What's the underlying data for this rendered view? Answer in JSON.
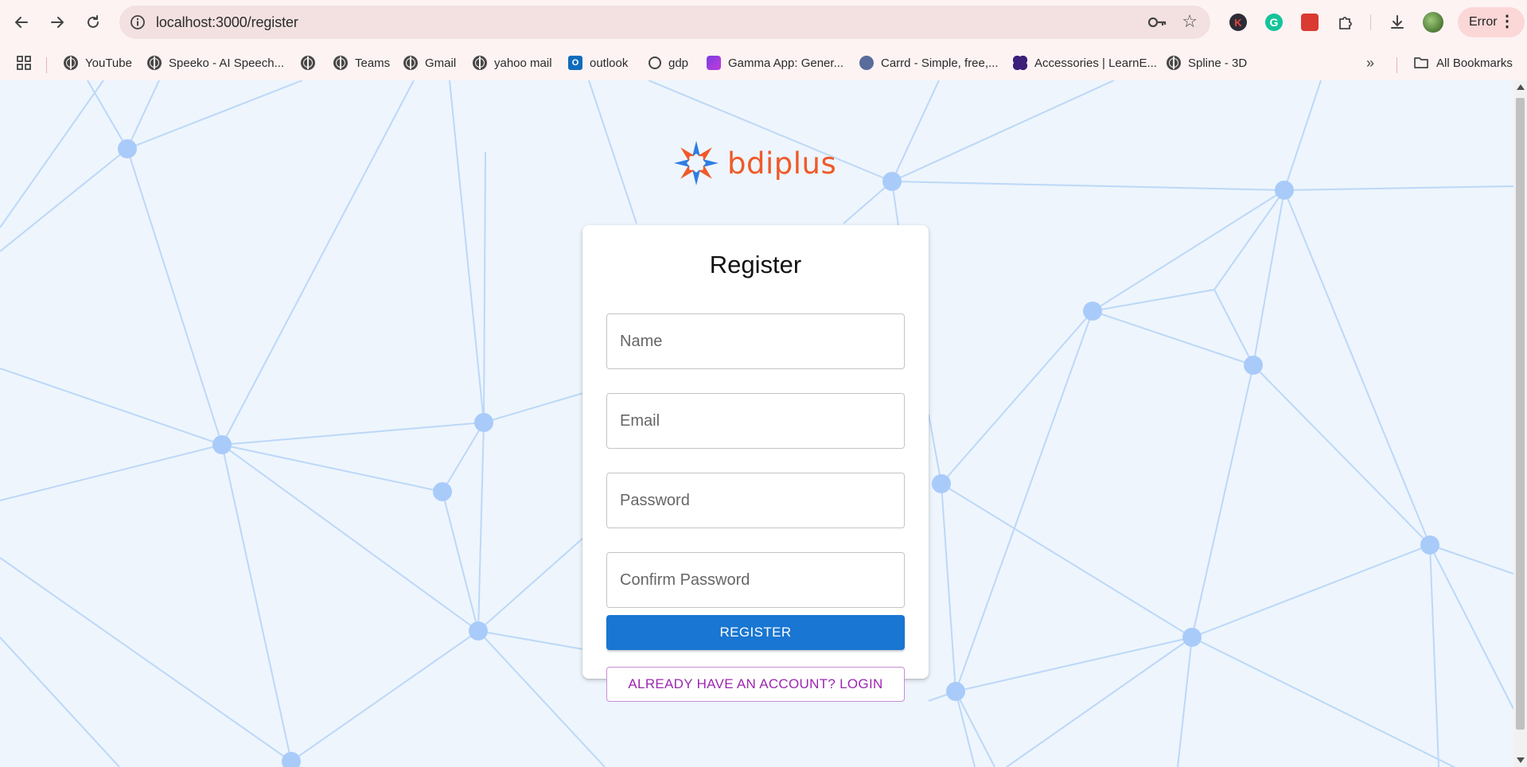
{
  "browser": {
    "url": "localhost:3000/register",
    "profile_status": "Error",
    "bookmarks": [
      {
        "label": "YouTube",
        "icon": "globe-icon"
      },
      {
        "label": "Speeko - AI Speech...",
        "icon": "globe-icon"
      },
      {
        "label": "",
        "icon": "globe-icon"
      },
      {
        "label": "Teams",
        "icon": "globe-icon"
      },
      {
        "label": "Gmail",
        "icon": "globe-icon"
      },
      {
        "label": "yahoo mail",
        "icon": "globe-icon"
      },
      {
        "label": "outlook",
        "icon": "outlook-icon"
      },
      {
        "label": "gdp",
        "icon": "openai-icon"
      },
      {
        "label": "Gamma App: Gener...",
        "icon": "gamma-icon"
      },
      {
        "label": "Carrd - Simple, free,...",
        "icon": "carrd-icon"
      },
      {
        "label": "Accessories | LearnE...",
        "icon": "learne-icon"
      },
      {
        "label": "Spline - 3D",
        "icon": "globe-icon"
      }
    ],
    "all_bookmarks": "All Bookmarks"
  },
  "logo": {
    "text": "bdiplus",
    "color": "#ef5a28"
  },
  "form": {
    "title": "Register",
    "fields": {
      "name": {
        "placeholder": "Name",
        "value": ""
      },
      "email": {
        "placeholder": "Email",
        "value": ""
      },
      "password": {
        "placeholder": "Password",
        "value": ""
      },
      "confirm_password": {
        "placeholder": "Confirm Password",
        "value": ""
      }
    },
    "register_label": "REGISTER",
    "login_label": "ALREADY HAVE AN ACCOUNT? LOGIN"
  },
  "colors": {
    "primary": "#1976d2",
    "secondary": "#9c27b0",
    "background": "#eef5fd",
    "network_line": "#bcd8f7",
    "network_node": "#a9cbfa"
  }
}
